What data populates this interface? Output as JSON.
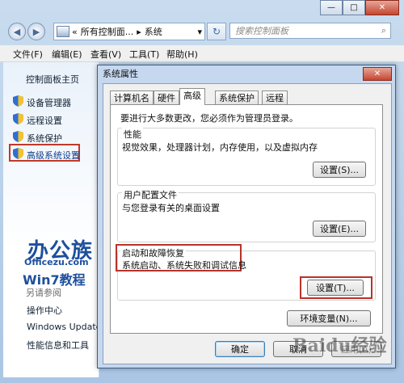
{
  "window": {
    "controls": {
      "minimize": "—",
      "maximize": "□",
      "close": "✕"
    }
  },
  "nav": {
    "back": "◀",
    "forward": "▶",
    "address_prefix": "«",
    "address_part1": "所有控制面...",
    "address_sep": "▸",
    "address_part2": "系统",
    "address_dropdown": "▾",
    "search_placeholder": "搜索控制面板"
  },
  "menubar": {
    "items": [
      "文件(F)",
      "编辑(E)",
      "查看(V)",
      "工具(T)",
      "帮助(H)"
    ]
  },
  "left_pane": {
    "home": "控制面板主页",
    "links": [
      "设备管理器",
      "远程设置",
      "系统保护",
      "高级系统设置"
    ],
    "logo_main": "办公族",
    "logo_site": "Officezu.com",
    "logo_sub": "Win7教程",
    "see_also": "另请参阅",
    "see_also_links": [
      "操作中心",
      "Windows Update",
      "性能信息和工具"
    ]
  },
  "dialog": {
    "title": "系统属性",
    "close": "✕",
    "tabs": [
      "计算机名",
      "硬件",
      "高级",
      "系统保护",
      "远程"
    ],
    "active_tab": "高级",
    "admin_note": "要进行大多数更改，您必须作为管理员登录。",
    "performance": {
      "title": "性能",
      "desc": "视觉效果，处理器计划，内存使用，以及虚拟内存",
      "button": "设置(S)..."
    },
    "profiles": {
      "title": "用户配置文件",
      "desc": "与您登录有关的桌面设置",
      "button": "设置(E)..."
    },
    "startup": {
      "title": "启动和故障恢复",
      "desc": "系统启动、系统失败和调试信息",
      "button": "设置(T)..."
    },
    "env_button": "环境变量(N)...",
    "ok": "确定",
    "cancel": "取消",
    "apply": "应用(A)"
  },
  "watermark": "Baidu经验",
  "colors": {
    "highlight_red": "#c0392b",
    "dialog_frame": "#c5d8ef",
    "link_text": "#123"
  }
}
